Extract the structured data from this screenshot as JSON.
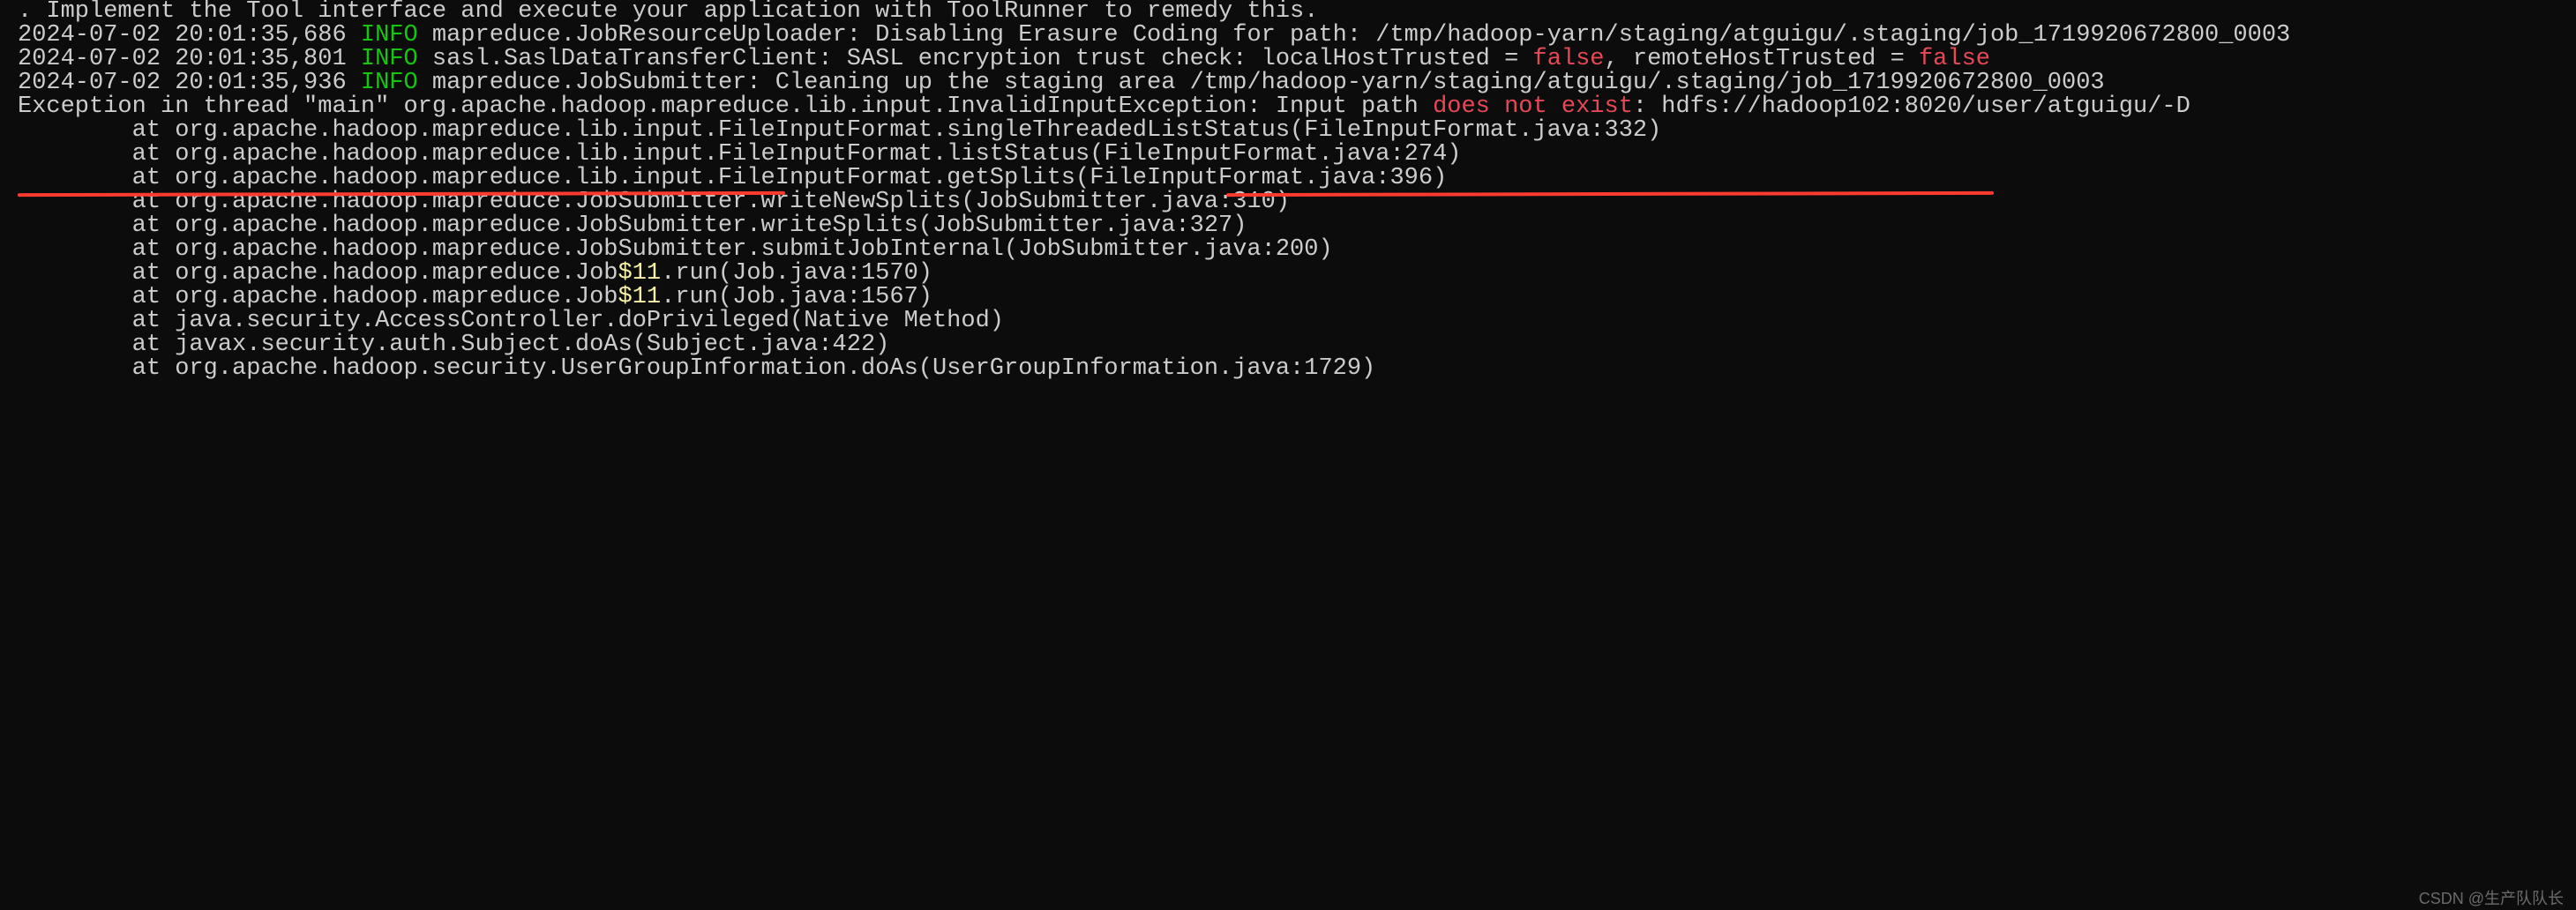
{
  "lines": [
    {
      "segments": [
        {
          "text": ". Implement the Tool interface and execute your application with ToolRunner to remedy this."
        }
      ]
    },
    {
      "segments": [
        {
          "text": "2024-07-02 20:01:35,686 "
        },
        {
          "text": "INFO",
          "cls": "info"
        },
        {
          "text": " mapreduce.JobResourceUploader: Disabling Erasure Coding for path: /tmp/hadoop-yarn/staging/atguigu/.staging/job_1719920672800_0003"
        }
      ]
    },
    {
      "segments": [
        {
          "text": "2024-07-02 20:01:35,801 "
        },
        {
          "text": "INFO",
          "cls": "info"
        },
        {
          "text": " sasl.SaslDataTransferClient: SASL encryption trust check: localHostTrusted = "
        },
        {
          "text": "false",
          "cls": "error"
        },
        {
          "text": ", remoteHostTrusted = "
        },
        {
          "text": "false",
          "cls": "error"
        }
      ]
    },
    {
      "segments": [
        {
          "text": "2024-07-02 20:01:35,936 "
        },
        {
          "text": "INFO",
          "cls": "info"
        },
        {
          "text": " mapreduce.JobSubmitter: Cleaning up the staging area /tmp/hadoop-yarn/staging/atguigu/.staging/job_1719920672800_0003"
        }
      ]
    },
    {
      "segments": [
        {
          "text": "Exception in thread \"main\" org.apache.hadoop.mapreduce.lib.input.InvalidInputException: Input path "
        },
        {
          "text": "does not exist",
          "cls": "error"
        },
        {
          "text": ": hdfs://hadoop102:8020/user/atguigu/-D"
        }
      ]
    },
    {
      "segments": [
        {
          "text": "        at org.apache.hadoop.mapreduce.lib.input.FileInputFormat.singleThreadedListStatus(FileInputFormat.java:332)"
        }
      ]
    },
    {
      "segments": [
        {
          "text": "        at org.apache.hadoop.mapreduce.lib.input.FileInputFormat.listStatus(FileInputFormat.java:274)"
        }
      ]
    },
    {
      "segments": [
        {
          "text": "        at org.apache.hadoop.mapreduce.lib.input.FileInputFormat.getSplits(FileInputFormat.java:396)"
        }
      ]
    },
    {
      "segments": [
        {
          "text": "        at org.apache.hadoop.mapreduce.JobSubmitter.writeNewSplits(JobSubmitter.java:310)"
        }
      ]
    },
    {
      "segments": [
        {
          "text": "        at org.apache.hadoop.mapreduce.JobSubmitter.writeSplits(JobSubmitter.java:327)"
        }
      ]
    },
    {
      "segments": [
        {
          "text": "        at org.apache.hadoop.mapreduce.JobSubmitter.submitJobInternal(JobSubmitter.java:200)"
        }
      ]
    },
    {
      "segments": [
        {
          "text": "        at org.apache.hadoop.mapreduce.Job"
        },
        {
          "text": "$11",
          "cls": "num"
        },
        {
          "text": ".run(Job.java:1570)"
        }
      ]
    },
    {
      "segments": [
        {
          "text": "        at org.apache.hadoop.mapreduce.Job"
        },
        {
          "text": "$11",
          "cls": "num"
        },
        {
          "text": ".run(Job.java:1567)"
        }
      ]
    },
    {
      "segments": [
        {
          "text": "        at java.security.AccessController.doPrivileged(Native Method)"
        }
      ]
    },
    {
      "segments": [
        {
          "text": "        at javax.security.auth.Subject.doAs(Subject.java:422)"
        }
      ]
    },
    {
      "segments": [
        {
          "text": "        at org.apache.hadoop.security.UserGroupInformation.doAs(UserGroupInformation.java:1729)"
        }
      ]
    }
  ],
  "watermark": "CSDN @生产队队长"
}
